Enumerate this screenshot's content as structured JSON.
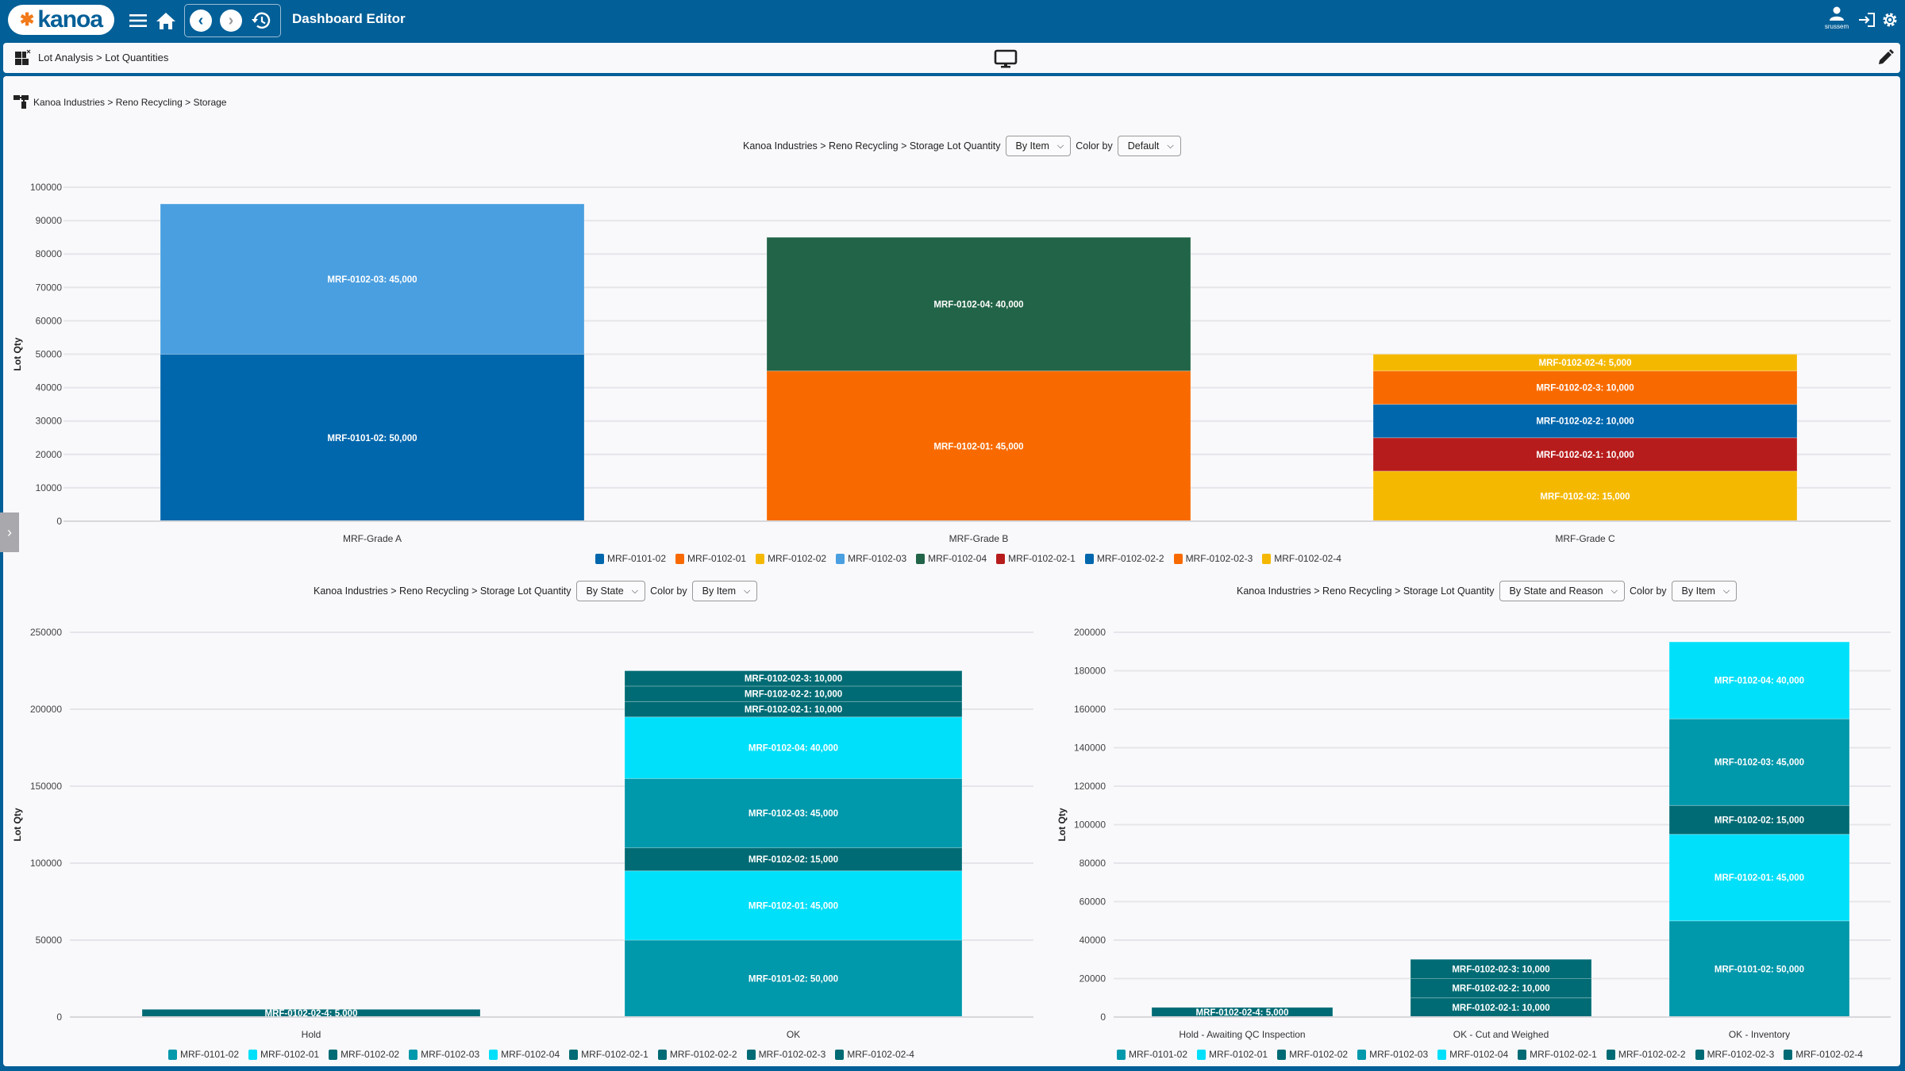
{
  "app": {
    "logo_text": "kanoa",
    "title": "Dashboard Editor",
    "username": "srussem",
    "icons": [
      "menu-icon",
      "home-icon",
      "back-icon",
      "forward-icon",
      "history-icon",
      "user-icon",
      "logout-icon",
      "settings-icon"
    ]
  },
  "breadcrumb": {
    "text": "Lot Analysis > Lot Quantities"
  },
  "location": {
    "text": "Kanoa Industries > Reno Recycling > Storage"
  },
  "colors": {
    "brand": "#035f97",
    "MRF-0101-02": "#0067ad",
    "MRF-0102-01": "#f86a00",
    "MRF-0102-02": "#f5b800",
    "MRF-0102-03": "#4a9fe0",
    "MRF-0102-04": "#226448",
    "MRF-0102-02-1": "#b71c1c",
    "MRF-0102-02-2": "#0067ad",
    "MRF-0102-02-3": "#f86a00",
    "MRF-0102-02-4": "#f5b800",
    "teal_mid": "#0098ab",
    "teal_cyan": "#00e0fa",
    "teal_dark": "#006b74"
  },
  "chart_data": [
    {
      "type": "bar",
      "stacked": true,
      "title": "Kanoa Industries > Reno Recycling > Storage Lot Quantity",
      "group_by_label": "By Item",
      "color_by_label": "Color by",
      "color_by_value": "Default",
      "xlabel": "",
      "ylabel": "Lot Qty",
      "ylim": [
        0,
        100000
      ],
      "yticks": [
        0,
        10000,
        20000,
        30000,
        40000,
        50000,
        60000,
        70000,
        80000,
        90000,
        100000
      ],
      "categories": [
        "MRF-Grade A",
        "MRF-Grade B",
        "MRF-Grade C"
      ],
      "segments": [
        [
          {
            "item": "MRF-0101-02",
            "value": 50000,
            "color": "#0067ad"
          },
          {
            "item": "MRF-0102-03",
            "value": 45000,
            "color": "#4a9fe0"
          }
        ],
        [
          {
            "item": "MRF-0102-01",
            "value": 45000,
            "color": "#f86a00"
          },
          {
            "item": "MRF-0102-04",
            "value": 40000,
            "color": "#226448"
          }
        ],
        [
          {
            "item": "MRF-0102-02",
            "value": 15000,
            "color": "#f5b800"
          },
          {
            "item": "MRF-0102-02-1",
            "value": 10000,
            "color": "#b71c1c"
          },
          {
            "item": "MRF-0102-02-2",
            "value": 10000,
            "color": "#0067ad"
          },
          {
            "item": "MRF-0102-02-3",
            "value": 10000,
            "color": "#f86a00"
          },
          {
            "item": "MRF-0102-02-4",
            "value": 5000,
            "color": "#f5b800"
          }
        ]
      ],
      "legend": [
        {
          "label": "MRF-0101-02",
          "color": "#0067ad"
        },
        {
          "label": "MRF-0102-01",
          "color": "#f86a00"
        },
        {
          "label": "MRF-0102-02",
          "color": "#f5b800"
        },
        {
          "label": "MRF-0102-03",
          "color": "#4a9fe0"
        },
        {
          "label": "MRF-0102-04",
          "color": "#226448"
        },
        {
          "label": "MRF-0102-02-1",
          "color": "#b71c1c"
        },
        {
          "label": "MRF-0102-02-2",
          "color": "#0067ad"
        },
        {
          "label": "MRF-0102-02-3",
          "color": "#f86a00"
        },
        {
          "label": "MRF-0102-02-4",
          "color": "#f5b800"
        }
      ],
      "legend_position": "bottom"
    },
    {
      "type": "bar",
      "stacked": true,
      "title": "Kanoa Industries > Reno Recycling > Storage Lot Quantity",
      "group_by_label": "By State",
      "color_by_label": "Color by",
      "color_by_value": "By Item",
      "xlabel": "",
      "ylabel": "Lot Qty",
      "ylim": [
        0,
        250000
      ],
      "yticks": [
        0,
        50000,
        100000,
        150000,
        200000,
        250000
      ],
      "categories": [
        "Hold",
        "OK"
      ],
      "segments": [
        [
          {
            "item": "MRF-0102-02-4",
            "value": 5000,
            "color": "#006b74"
          }
        ],
        [
          {
            "item": "MRF-0101-02",
            "value": 50000,
            "color": "#0098ab"
          },
          {
            "item": "MRF-0102-01",
            "value": 45000,
            "color": "#00e0fa"
          },
          {
            "item": "MRF-0102-02",
            "value": 15000,
            "color": "#006b74"
          },
          {
            "item": "MRF-0102-03",
            "value": 45000,
            "color": "#0098ab"
          },
          {
            "item": "MRF-0102-04",
            "value": 40000,
            "color": "#00e0fa"
          },
          {
            "item": "MRF-0102-02-1",
            "value": 10000,
            "color": "#006b74"
          },
          {
            "item": "MRF-0102-02-2",
            "value": 10000,
            "color": "#006b74"
          },
          {
            "item": "MRF-0102-02-3",
            "value": 10000,
            "color": "#006b74"
          }
        ]
      ],
      "legend": [
        {
          "label": "MRF-0101-02",
          "color": "#0098ab"
        },
        {
          "label": "MRF-0102-01",
          "color": "#00e0fa"
        },
        {
          "label": "MRF-0102-02",
          "color": "#006b74"
        },
        {
          "label": "MRF-0102-03",
          "color": "#0098ab"
        },
        {
          "label": "MRF-0102-04",
          "color": "#00e0fa"
        },
        {
          "label": "MRF-0102-02-1",
          "color": "#006b74"
        },
        {
          "label": "MRF-0102-02-2",
          "color": "#006b74"
        },
        {
          "label": "MRF-0102-02-3",
          "color": "#006b74"
        },
        {
          "label": "MRF-0102-02-4",
          "color": "#006b74"
        }
      ],
      "legend_position": "bottom"
    },
    {
      "type": "bar",
      "stacked": true,
      "title": "Kanoa Industries > Reno Recycling > Storage Lot Quantity",
      "group_by_label": "By State and Reason",
      "color_by_label": "Color by",
      "color_by_value": "By Item",
      "xlabel": "",
      "ylabel": "Lot Qty",
      "ylim": [
        0,
        200000
      ],
      "yticks": [
        0,
        20000,
        40000,
        60000,
        80000,
        100000,
        120000,
        140000,
        160000,
        180000,
        200000
      ],
      "categories": [
        "Hold - Awaiting QC Inspection",
        "OK - Cut and Weighed",
        "OK - Inventory"
      ],
      "segments": [
        [
          {
            "item": "MRF-0102-02-4",
            "value": 5000,
            "color": "#006b74"
          }
        ],
        [
          {
            "item": "MRF-0102-02-1",
            "value": 10000,
            "color": "#006b74"
          },
          {
            "item": "MRF-0102-02-2",
            "value": 10000,
            "color": "#006b74"
          },
          {
            "item": "MRF-0102-02-3",
            "value": 10000,
            "color": "#006b74"
          }
        ],
        [
          {
            "item": "MRF-0101-02",
            "value": 50000,
            "color": "#0098ab"
          },
          {
            "item": "MRF-0102-01",
            "value": 45000,
            "color": "#00e0fa"
          },
          {
            "item": "MRF-0102-02",
            "value": 15000,
            "color": "#006b74"
          },
          {
            "item": "MRF-0102-03",
            "value": 45000,
            "color": "#0098ab"
          },
          {
            "item": "MRF-0102-04",
            "value": 40000,
            "color": "#00e0fa"
          }
        ]
      ],
      "legend": [
        {
          "label": "MRF-0101-02",
          "color": "#0098ab"
        },
        {
          "label": "MRF-0102-01",
          "color": "#00e0fa"
        },
        {
          "label": "MRF-0102-02",
          "color": "#006b74"
        },
        {
          "label": "MRF-0102-03",
          "color": "#0098ab"
        },
        {
          "label": "MRF-0102-04",
          "color": "#00e0fa"
        },
        {
          "label": "MRF-0102-02-1",
          "color": "#006b74"
        },
        {
          "label": "MRF-0102-02-2",
          "color": "#006b74"
        },
        {
          "label": "MRF-0102-02-3",
          "color": "#006b74"
        },
        {
          "label": "MRF-0102-02-4",
          "color": "#006b74"
        }
      ],
      "legend_position": "bottom"
    }
  ]
}
